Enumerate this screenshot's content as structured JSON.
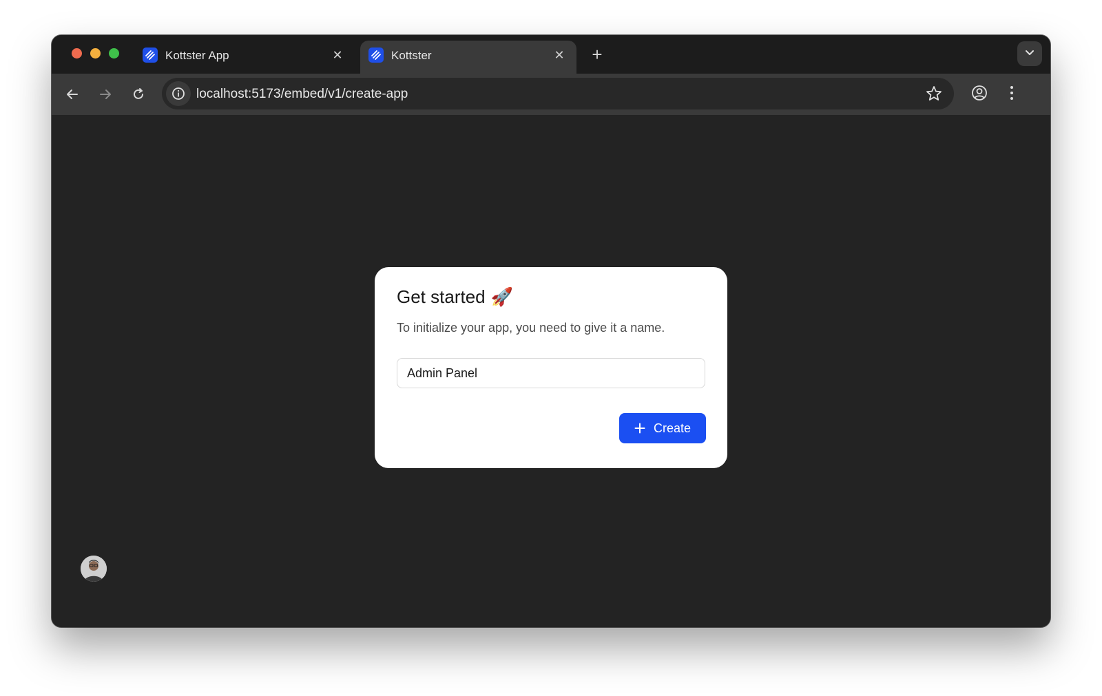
{
  "tabs": [
    {
      "title": "Kottster App",
      "active": false
    },
    {
      "title": "Kottster",
      "active": true
    }
  ],
  "toolbar": {
    "url": "localhost:5173/embed/v1/create-app"
  },
  "card": {
    "title": "Get started",
    "title_emoji": "🚀",
    "description": "To initialize your app, you need to give it a name.",
    "input_value": "Admin Panel",
    "button_label": "Create"
  },
  "colors": {
    "accent": "#1b4ff2",
    "background": "#232323",
    "tab_active": "#3a3a3a"
  },
  "icons": {
    "favicon": "kottster-logo-icon",
    "back": "arrow-left-icon",
    "forward": "arrow-right-icon",
    "reload": "reload-icon",
    "site_info": "info-icon",
    "bookmark": "star-icon",
    "profile": "profile-icon",
    "menu": "kebab-menu-icon",
    "tab_search": "chevron-down-icon",
    "create": "plus-icon"
  }
}
